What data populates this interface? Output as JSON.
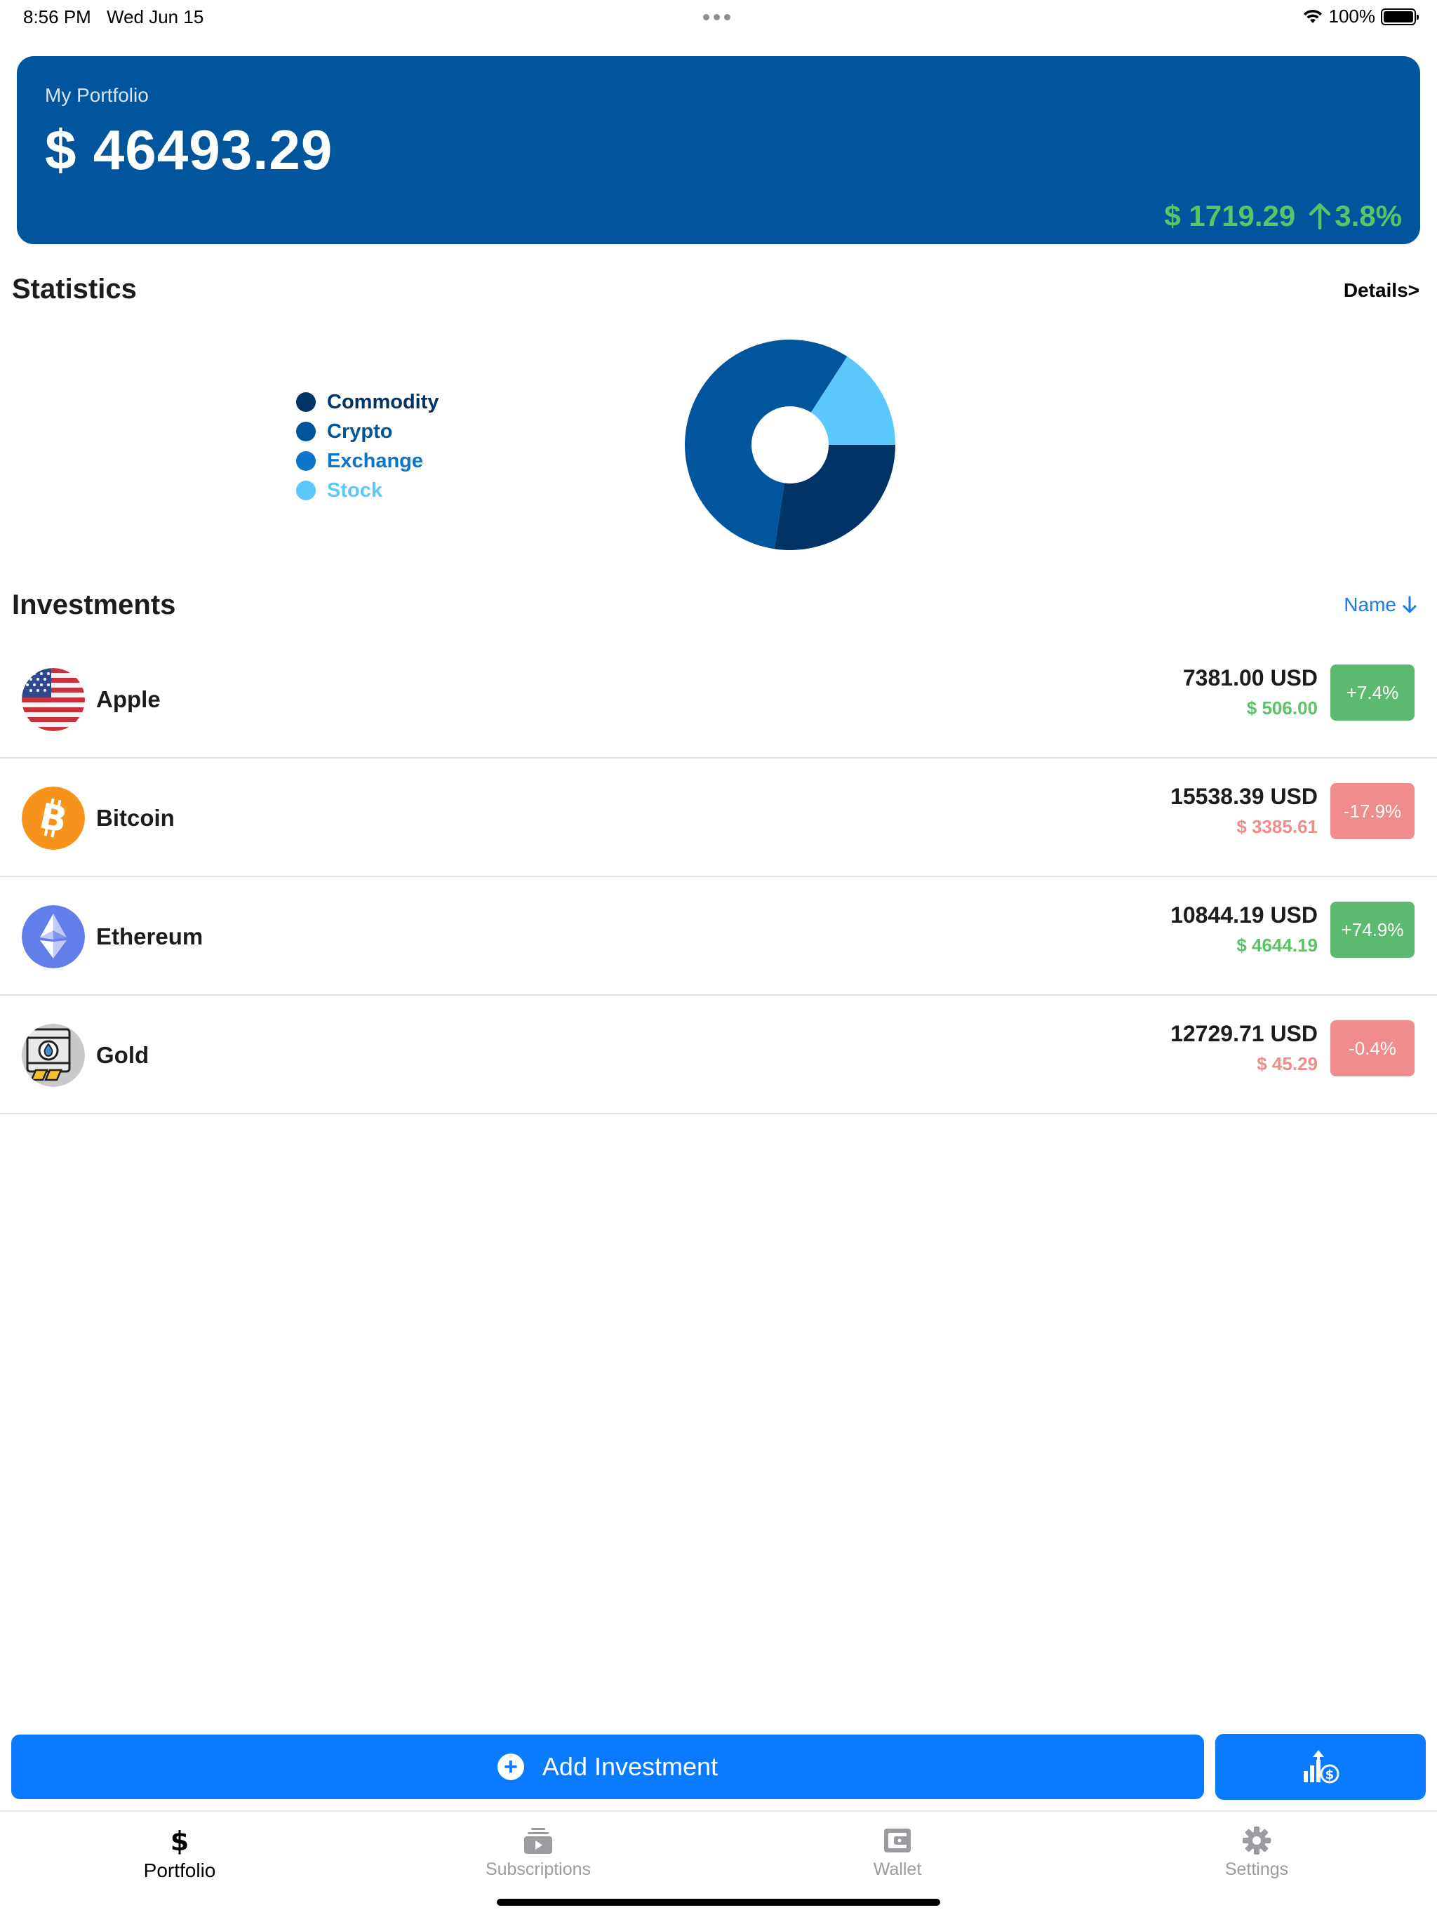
{
  "status_bar": {
    "time": "8:56 PM",
    "date": "Wed Jun 15",
    "battery": "100%"
  },
  "portfolio": {
    "label": "My Portfolio",
    "total": "$ 46493.29",
    "change_amount": "$ 1719.29",
    "change_percent": "3.8%",
    "change_direction": "up"
  },
  "statistics": {
    "title": "Statistics",
    "details_link": "Details>",
    "legend": [
      {
        "label": "Commodity",
        "color": "#003366"
      },
      {
        "label": "Crypto",
        "color": "#00559c"
      },
      {
        "label": "Exchange",
        "color": "#0d74cc"
      },
      {
        "label": "Stock",
        "color": "#5ac8fa"
      }
    ],
    "chart_data": {
      "type": "pie",
      "categories": [
        "Commodity",
        "Crypto",
        "Exchange",
        "Stock"
      ],
      "values": [
        12729.71,
        26382.58,
        0,
        7381.0
      ],
      "colors": [
        "#003366",
        "#00559c",
        "#0d74cc",
        "#5ac8fa"
      ]
    }
  },
  "investments": {
    "title": "Investments",
    "sort_label": "Name",
    "items": [
      {
        "name": "Apple",
        "icon": "us-flag-icon",
        "value": "7381.00 USD",
        "delta": "$ 506.00",
        "badge": "+7.4%",
        "trend": "positive"
      },
      {
        "name": "Bitcoin",
        "icon": "bitcoin-icon",
        "value": "15538.39 USD",
        "delta": "$ 3385.61",
        "badge": "-17.9%",
        "trend": "negative"
      },
      {
        "name": "Ethereum",
        "icon": "ethereum-icon",
        "value": "10844.19 USD",
        "delta": "$ 4644.19",
        "badge": "+74.9%",
        "trend": "positive"
      },
      {
        "name": "Gold",
        "icon": "gold-bars-icon",
        "value": "12729.71 USD",
        "delta": "$ 45.29",
        "badge": "-0.4%",
        "trend": "negative"
      }
    ]
  },
  "actions": {
    "add_investment": "Add Investment",
    "secondary_icon": "growth-dollar-icon"
  },
  "tab_bar": {
    "tabs": [
      {
        "label": "Portfolio",
        "icon": "dollar-icon",
        "active": true
      },
      {
        "label": "Subscriptions",
        "icon": "subscriptions-icon",
        "active": false
      },
      {
        "label": "Wallet",
        "icon": "wallet-icon",
        "active": false
      },
      {
        "label": "Settings",
        "icon": "gear-icon",
        "active": false
      }
    ]
  }
}
